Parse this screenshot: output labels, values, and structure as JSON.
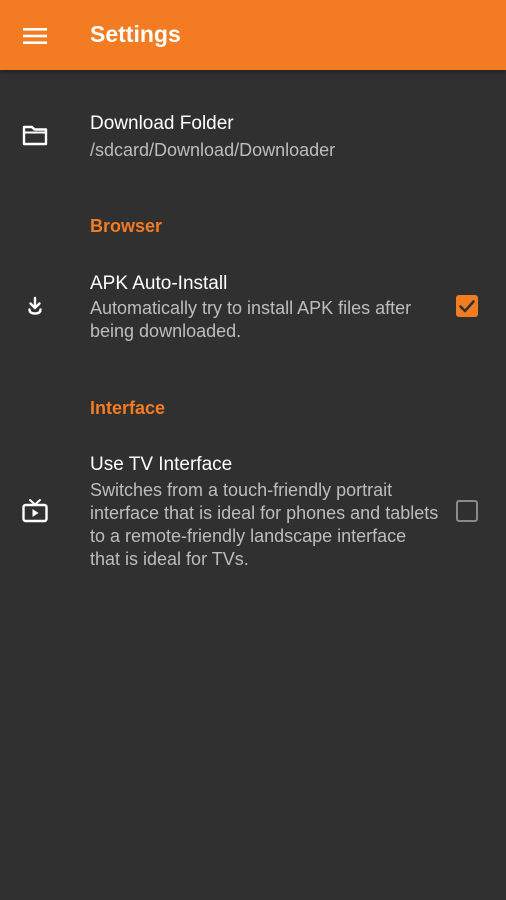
{
  "appbar": {
    "title": "Settings",
    "menu_icon": "hamburger-menu-icon",
    "background": "#f37c22"
  },
  "download_folder": {
    "icon": "folder-icon",
    "title": "Download Folder",
    "summary": "/sdcard/Download/Downloader"
  },
  "browser": {
    "category": "Browser",
    "apk_auto_install": {
      "icon": "download-arrow-icon",
      "title": "APK Auto-Install",
      "summary": "Automatically try to install APK files after being downloaded.",
      "checked": true
    }
  },
  "interface": {
    "category": "Interface",
    "tv_interface": {
      "icon": "tv-play-icon",
      "title": "Use TV Interface",
      "summary": "Switches from a touch-friendly portrait interface that is ideal for phones and tablets to a remote-friendly landscape interface that is ideal for TVs.",
      "checked": false
    }
  },
  "colors": {
    "accent": "#f37c22",
    "background": "#303030"
  }
}
